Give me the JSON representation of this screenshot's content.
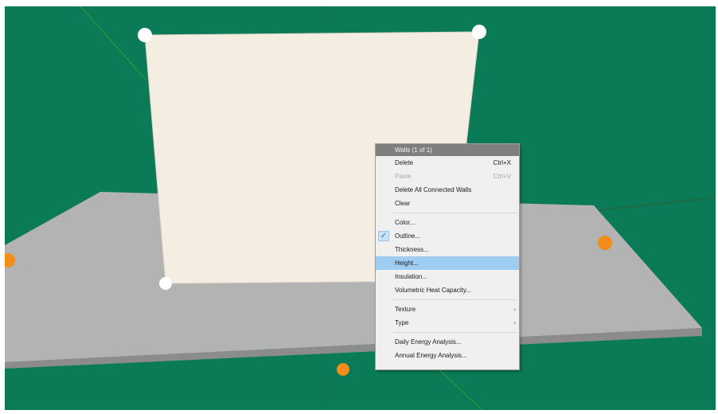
{
  "context_menu": {
    "title": "Walls (1 of 1)",
    "items": [
      {
        "label": "Delete",
        "shortcut": "Ctrl+X"
      },
      {
        "label": "Paste",
        "shortcut": "Ctrl+V",
        "disabled": true
      },
      {
        "label": "Delete All Connected Walls"
      },
      {
        "label": "Clear"
      },
      {
        "label": "Color..."
      },
      {
        "label": "Outline...",
        "checked": true
      },
      {
        "label": "Thickness..."
      },
      {
        "label": "Height...",
        "highlighted": true
      },
      {
        "label": "Insulation..."
      },
      {
        "label": "Volumetric Heat Capacity..."
      },
      {
        "label": "Texture",
        "submenu": true
      },
      {
        "label": "Type",
        "submenu": true
      },
      {
        "label": "Daily Energy Analysis..."
      },
      {
        "label": "Annual Energy Analysis..."
      }
    ],
    "check_mark": "✓",
    "submenu_arrow": "›"
  },
  "scene": {
    "background_color": "#0b7a56",
    "ground_color": "#b3b3b3",
    "wall_color": "#f3ede2",
    "handle_color": "#ffffff",
    "marker_color": "#f28c1a"
  }
}
